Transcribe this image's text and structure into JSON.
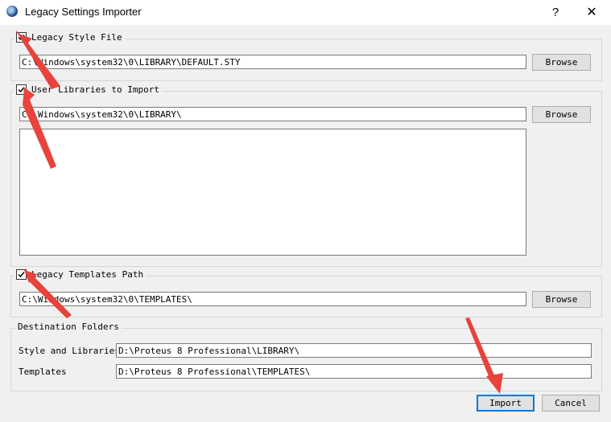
{
  "window": {
    "title": "Legacy Settings Importer",
    "help_glyph": "?",
    "close_glyph": "✕"
  },
  "style_file": {
    "label": "Legacy Style File",
    "checked": true,
    "path": "C:\\Windows\\system32\\0\\LIBRARY\\DEFAULT.STY",
    "browse_label": "Browse"
  },
  "user_libraries": {
    "label": "User Libraries to Import",
    "checked": true,
    "path": "C:\\Windows\\system32\\0\\LIBRARY\\",
    "browse_label": "Browse"
  },
  "templates_path": {
    "label": "Legacy Templates Path",
    "checked": true,
    "path": "C:\\Windows\\system32\\0\\TEMPLATES\\",
    "browse_label": "Browse"
  },
  "destination": {
    "title": "Destination Folders",
    "style_libraries_label": "Style and Libraries",
    "style_libraries_value": "D:\\Proteus 8 Professional\\LIBRARY\\",
    "templates_label": "Templates",
    "templates_value": "D:\\Proteus 8 Professional\\TEMPLATES\\"
  },
  "footer": {
    "import_label": "Import",
    "cancel_label": "Cancel"
  },
  "colors": {
    "annotation_arrow": "#e8433c",
    "default_button_border": "#0078d7"
  }
}
